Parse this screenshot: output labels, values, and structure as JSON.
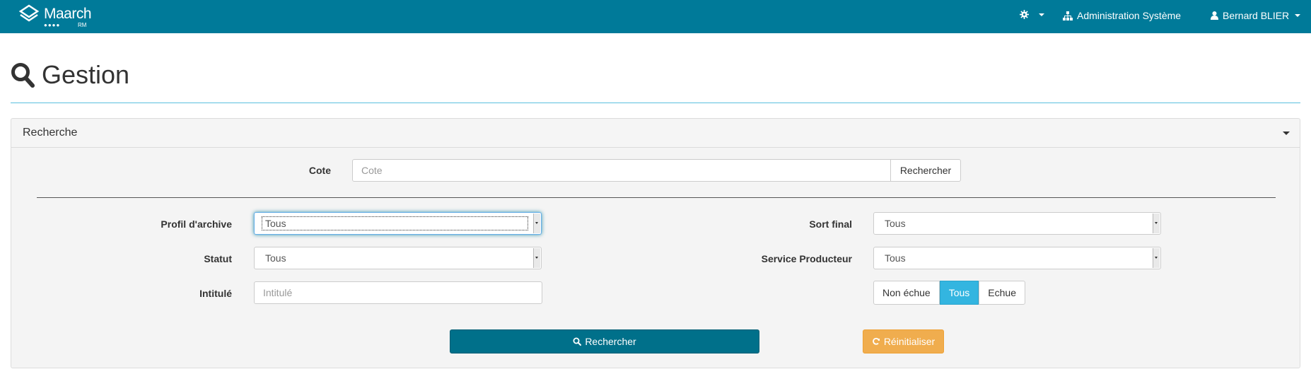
{
  "navbar": {
    "brand_name": "Maarch",
    "brand_dots": "●●●●",
    "brand_sub": "RM",
    "admin_label": "Administration Système",
    "user_label": "Bernard BLIER",
    "bg_color": "#007a99"
  },
  "page": {
    "title": "Gestion"
  },
  "panel": {
    "title": "Recherche",
    "cote": {
      "label": "Cote",
      "placeholder": "Cote",
      "button_label": "Rechercher"
    },
    "profil": {
      "label": "Profil d'archive",
      "value": "Tous"
    },
    "statut": {
      "label": "Statut",
      "value": "Tous"
    },
    "intitule": {
      "label": "Intitulé",
      "placeholder": "Intitulé"
    },
    "sort_final": {
      "label": "Sort final",
      "value": "Tous"
    },
    "service": {
      "label": "Service Producteur",
      "value": "Tous"
    },
    "echeance": {
      "options": [
        "Non échue",
        "Tous",
        "Echue"
      ],
      "selected": "Tous"
    },
    "search_button": "Rechercher",
    "reset_button": "Réinitialiser"
  },
  "colors": {
    "primary": "#00708a",
    "accent_active": "#33b5e0",
    "warning": "#f0ad4e"
  }
}
